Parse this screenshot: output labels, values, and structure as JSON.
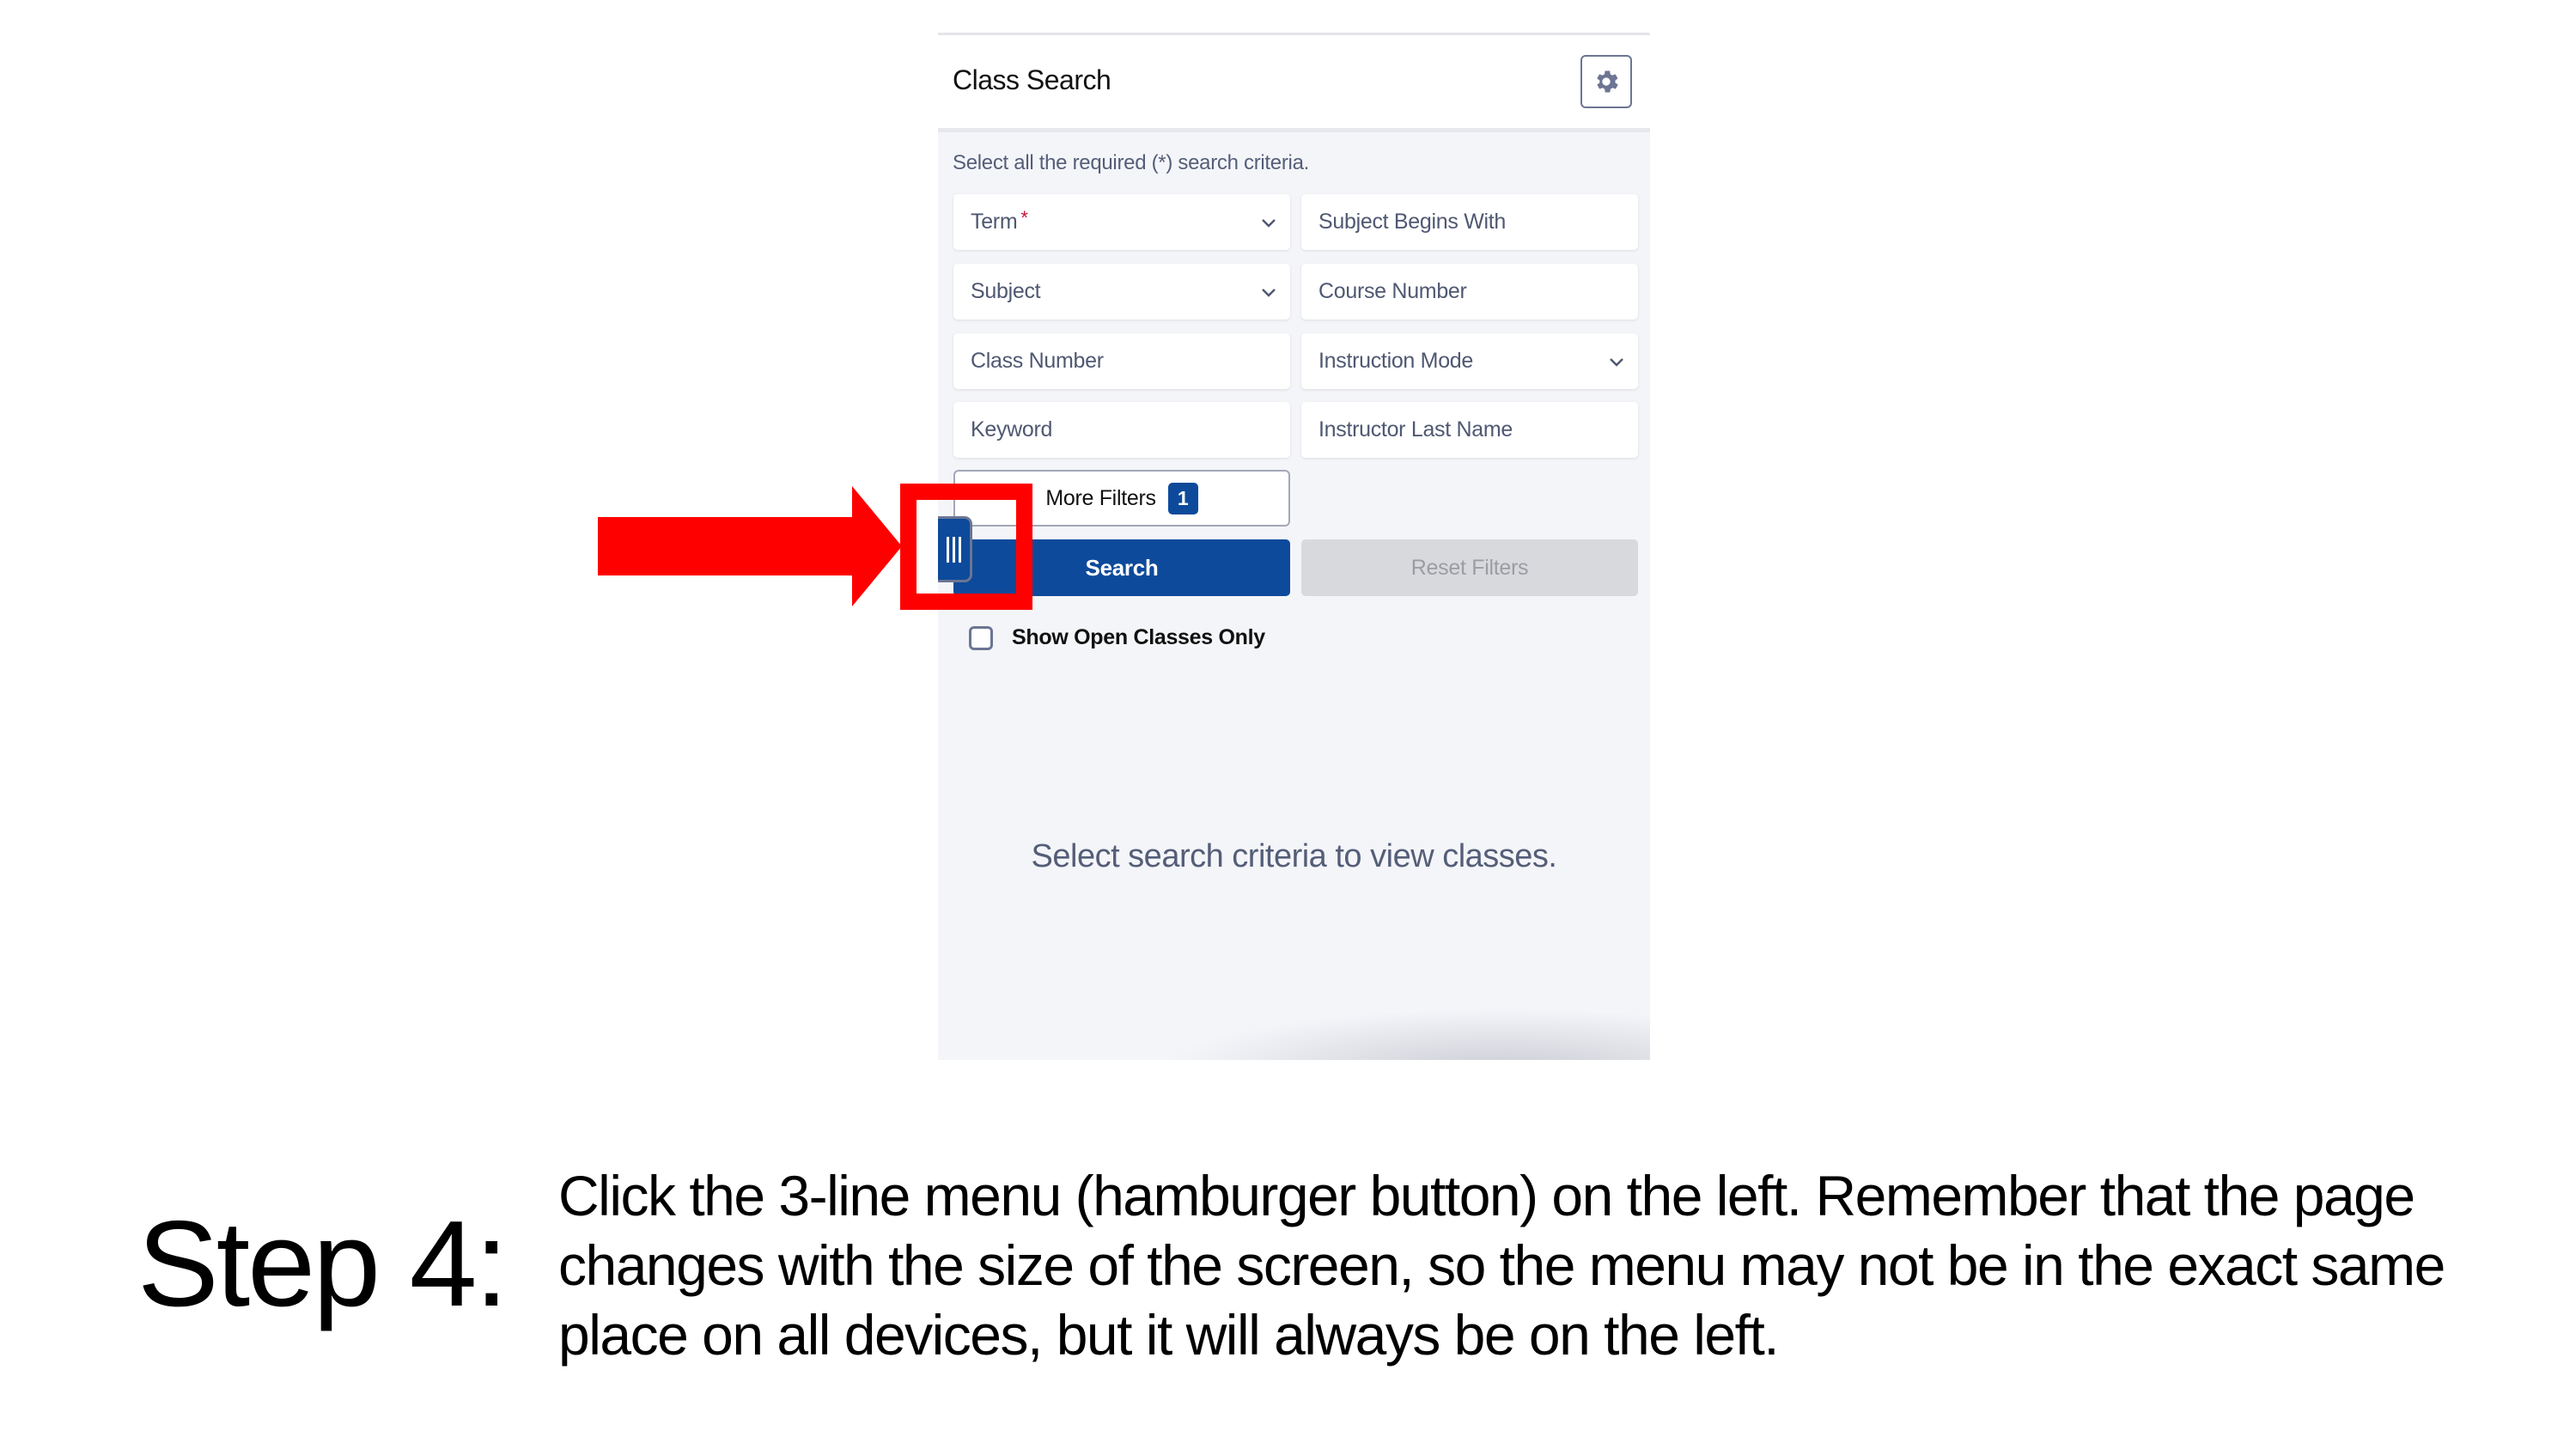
{
  "panel": {
    "title": "Class Search",
    "settings_icon": "gear-icon",
    "instruction": "Select all the required (*) search criteria.",
    "fields": [
      {
        "label": "Term",
        "required": "*",
        "type": "dropdown"
      },
      {
        "label": "Subject Begins With",
        "type": "text"
      },
      {
        "label": "Subject",
        "type": "dropdown"
      },
      {
        "label": "Course Number",
        "type": "text"
      },
      {
        "label": "Class Number",
        "type": "text"
      },
      {
        "label": "Instruction Mode",
        "type": "dropdown"
      },
      {
        "label": "Keyword",
        "type": "text"
      },
      {
        "label": "Instructor Last Name",
        "type": "text"
      }
    ],
    "more_filters": {
      "label": "More Filters",
      "count": "1"
    },
    "search_button": "Search",
    "reset_button": "Reset Filters",
    "open_classes_checkbox": {
      "label": "Show Open Classes Only",
      "checked": false
    },
    "empty_message": "Select search criteria to view classes.",
    "menu_icon": "hamburger-menu-icon"
  },
  "annotation": {
    "arrow_color": "#ff0000",
    "highlight_color": "#ff0000"
  },
  "step": {
    "label": "Step 4:",
    "text_prefix": "Click the ",
    "text_emphasis": "3-line menu (hamburger button)",
    "text_suffix": " on the left. Remember that the page changes with the size of the screen, so the menu may not be in the exact same place on all devices, but it will always be on the left."
  },
  "colors": {
    "primary": "#0d4a9b",
    "panel_bg": "#f4f5f9",
    "muted_text": "#545e78",
    "required": "#c8102e"
  }
}
